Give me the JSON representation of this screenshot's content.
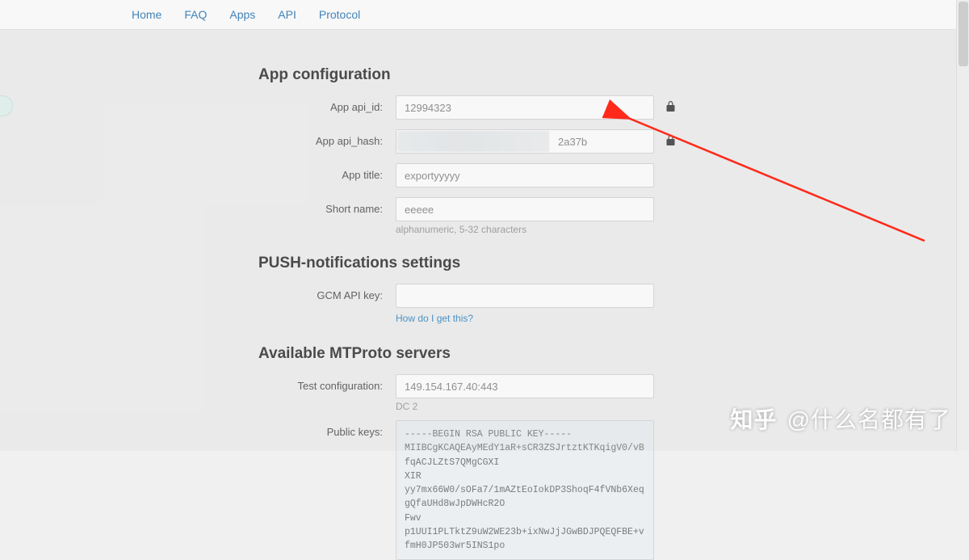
{
  "nav": {
    "items": [
      {
        "label": "Home"
      },
      {
        "label": "FAQ"
      },
      {
        "label": "Apps"
      },
      {
        "label": "API"
      },
      {
        "label": "Protocol"
      }
    ]
  },
  "sections": {
    "app_config": {
      "title": "App configuration",
      "fields": {
        "api_id": {
          "label": "App api_id:",
          "value": "12994323"
        },
        "api_hash": {
          "label": "App api_hash:",
          "visible_suffix": "2a37b"
        },
        "app_title": {
          "label": "App title:",
          "value": "exportyyyyy"
        },
        "short_name": {
          "label": "Short name:",
          "value": "eeeee",
          "help": "alphanumeric, 5-32 characters"
        }
      }
    },
    "push": {
      "title": "PUSH-notifications settings",
      "fields": {
        "gcm_key": {
          "label": "GCM API key:",
          "value": "",
          "help_link": "How do I get this?"
        }
      }
    },
    "mtproto": {
      "title": "Available MTProto servers",
      "fields": {
        "test_config": {
          "label": "Test configuration:",
          "value": "149.154.167.40:443",
          "dc": "DC 2"
        },
        "public_keys": {
          "label": "Public keys:",
          "value": "-----BEGIN RSA PUBLIC KEY-----\nMIIBCgKCAQEAyMEdY1aR+sCR3ZSJrtztKTKqigV0/vBfqACJLZtS7QMgCGXI\nXIR\nyy7mx66W0/sOFa7/1mAZtEoIokDP3ShoqF4fVNb6XeqgQfaUHd8wJpDWHcR2O\nFwv\np1UUI1PLTktZ9uW2WE23b+ixNwJjJGwBDJPQEQFBE+vfmH0JP503wr5INS1po"
        }
      }
    }
  },
  "watermark": {
    "logo": "知乎",
    "handle": "@什么名都有了"
  }
}
